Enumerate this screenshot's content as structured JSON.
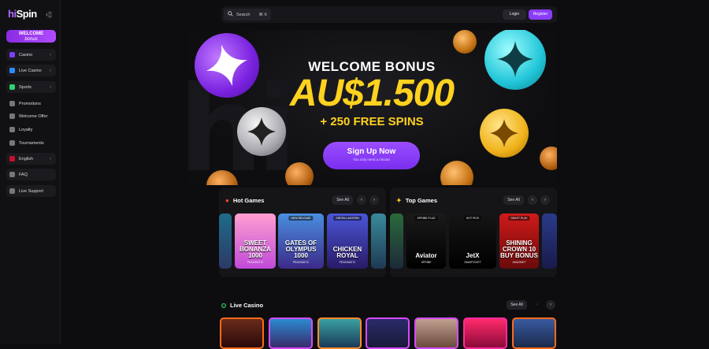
{
  "brand": {
    "logo_hi": "hi",
    "logo_rest": "Spin"
  },
  "sidebar": {
    "welcome": {
      "line1": "WELCOME",
      "line2": "bonus"
    },
    "items": [
      {
        "label": "Casino",
        "icon": "casino-icon",
        "color": "#7b3ff2",
        "chevron": "›"
      },
      {
        "label": "Live Casino",
        "icon": "live-casino-icon",
        "color": "#2b8cff",
        "chevron": "›"
      },
      {
        "label": "Sports",
        "icon": "sports-icon",
        "color": "#2dd36f",
        "chevron": "›"
      },
      {
        "label": "Promotions",
        "icon": "promotions-icon",
        "color": "#777",
        "chevron": ""
      },
      {
        "label": "Welcome Offer",
        "icon": "gift-icon",
        "color": "#777",
        "chevron": ""
      },
      {
        "label": "Loyalty",
        "icon": "crown-icon",
        "color": "#777",
        "chevron": ""
      },
      {
        "label": "Tournaments",
        "icon": "trophy-icon",
        "color": "#777",
        "chevron": ""
      },
      {
        "label": "English",
        "icon": "uk-flag-icon",
        "color": "#c8102e",
        "chevron": "›"
      },
      {
        "label": "FAQ",
        "icon": "faq-icon",
        "color": "#777",
        "chevron": ""
      },
      {
        "label": "Live Support",
        "icon": "headset-icon",
        "color": "#777",
        "chevron": ""
      }
    ]
  },
  "header": {
    "search_label": "Search",
    "search_shortcut": "⌘ K",
    "login": "Login",
    "register": "Register"
  },
  "hero": {
    "title": "WELCOME BONUS",
    "amount": "AU$1.500",
    "spins": "+ 250 FREE SPINS",
    "cta": "Sign Up Now",
    "cta_sub": "You only need a minute"
  },
  "hot_games": {
    "title": "Hot Games",
    "see_all": "See All",
    "tiles": [
      {
        "name": "",
        "prov": "",
        "badge": "",
        "bg": "linear-gradient(180deg,#1f6b8a,#2c3a66)"
      },
      {
        "name": "SWEET BONANZA 1000",
        "prov": "PRAGMATIC",
        "badge": "",
        "bg": "linear-gradient(180deg,#ff9fd0,#c04ad8)"
      },
      {
        "name": "GATES OF OLYMPUS 1000",
        "prov": "PRAGMATIC",
        "badge": "NEW RELEASE",
        "bg": "linear-gradient(180deg,#4a8fe0,#3b2a8a)"
      },
      {
        "name": "CHICKEN ROYAL",
        "prov": "PRAGMATIC",
        "badge": "GREEN LANTERN",
        "bg": "linear-gradient(180deg,#4a56d8,#2a1a66)"
      },
      {
        "name": "",
        "prov": "",
        "badge": "",
        "bg": "linear-gradient(180deg,#3a8a9a,#1d3a55)"
      }
    ]
  },
  "top_games": {
    "title": "Top Games",
    "see_all": "See All",
    "tiles": [
      {
        "name": "",
        "prov": "",
        "badge": "",
        "bg": "linear-gradient(180deg,#2a6a3a,#1d2a3a)"
      },
      {
        "name": "Aviator",
        "prov": "SPRIBE",
        "badge": "SPRIBE PLUS",
        "bg": "linear-gradient(180deg,#1a1a1a,#000)"
      },
      {
        "name": "JetX",
        "prov": "SMARTSOFT",
        "badge": "HOT PICK",
        "bg": "linear-gradient(180deg,#151515,#000)"
      },
      {
        "name": "SHINING CROWN 10 BUY BONUS",
        "prov": "AMUSNET",
        "badge": "DRAFT PLAY",
        "bg": "linear-gradient(180deg,#d01a1a,#6a0a0a)"
      },
      {
        "name": "",
        "prov": "",
        "badge": "",
        "bg": "linear-gradient(180deg,#2a3a8a,#1a1a4a)"
      }
    ]
  },
  "live_casino": {
    "title": "Live Casino",
    "see_all": "See All",
    "tiles": [
      {
        "border": "#ff6a1a",
        "bg": "linear-gradient(180deg,#6a2a1a,#2a0a0a)"
      },
      {
        "border": "#d64aff",
        "bg": "linear-gradient(180deg,#2a8ad0,#3a2a6a)"
      },
      {
        "border": "#ff8a2a",
        "bg": "linear-gradient(180deg,#3aa0a0,#1a3a5a)"
      },
      {
        "border": "#d64aff",
        "bg": "linear-gradient(180deg,#2a2a6a,#1a1a3a)"
      },
      {
        "border": "#d64aff",
        "bg": "linear-gradient(180deg,#c0a090,#6a4a3a)"
      },
      {
        "border": "#ff2aa0",
        "bg": "linear-gradient(180deg,#ff2a6a,#8a0a3a)"
      },
      {
        "border": "#ff6a1a",
        "bg": "linear-gradient(180deg,#3a5aa0,#1a2a4a)"
      }
    ]
  }
}
